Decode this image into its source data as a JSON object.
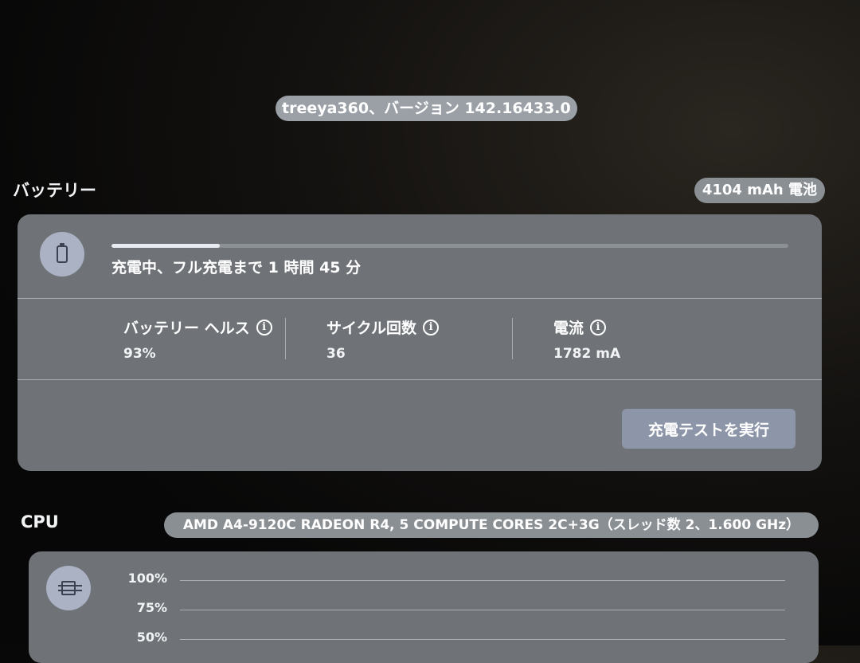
{
  "header": {
    "version_text": "treeya360、バージョン 142.16433.0"
  },
  "battery": {
    "title": "バッテリー",
    "capacity": "4104 mAh 電池",
    "charge_progress": 0.16,
    "status": "充電中、フル充電まで 1 時間 45 分",
    "metrics": [
      {
        "label": "バッテリー ヘルス",
        "value": "93%"
      },
      {
        "label": "サイクル回数",
        "value": "36"
      },
      {
        "label": "電流",
        "value": "1782 mA"
      }
    ],
    "action_button": "充電テストを実行"
  },
  "cpu": {
    "title": "CPU",
    "model": "AMD A4-9120C RADEON R4, 5 COMPUTE CORES 2C+3G（スレッド数 2、1.600 GHz）",
    "chart": {
      "y_ticks": [
        "100%",
        "75%",
        "50%"
      ]
    }
  }
}
